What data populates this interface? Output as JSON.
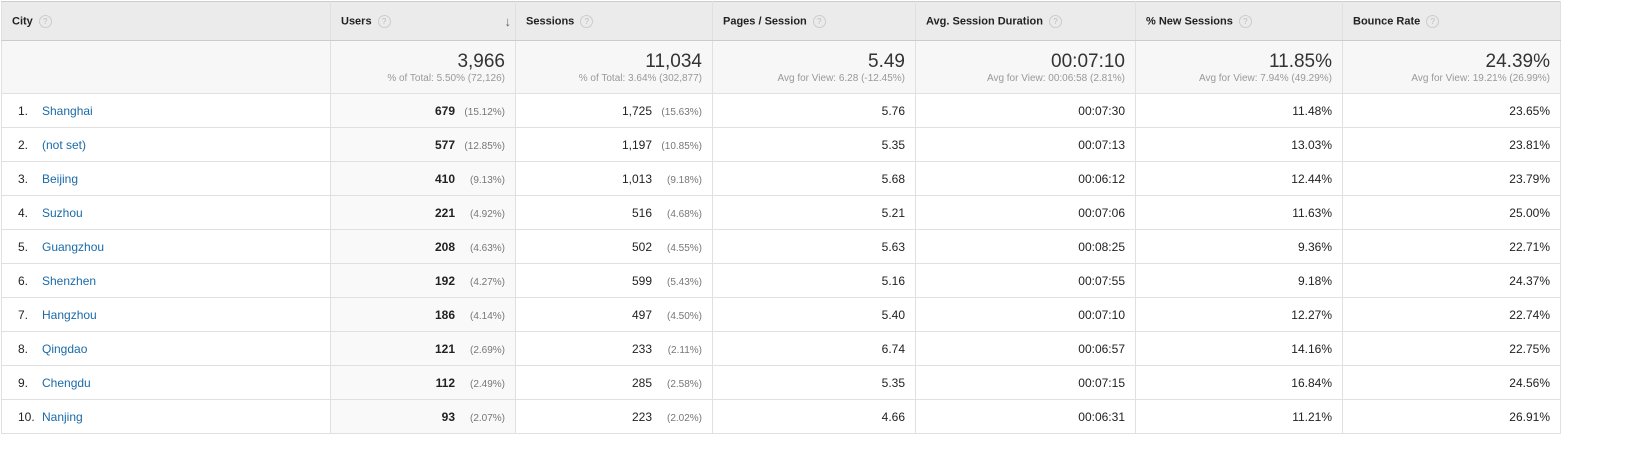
{
  "headers": [
    "City",
    "Users",
    "Sessions",
    "Pages / Session",
    "Avg. Session Duration",
    "% New Sessions",
    "Bounce Rate"
  ],
  "help_glyph": "?",
  "sort_arrow": "↓",
  "totals": [
    {
      "value": "3,966",
      "sub": "% of Total: 5.50% (72,126)"
    },
    {
      "value": "11,034",
      "sub": "% of Total: 3.64% (302,877)"
    },
    {
      "value": "5.49",
      "sub": "Avg for View: 6.28 (-12.45%)"
    },
    {
      "value": "00:07:10",
      "sub": "Avg for View: 00:06:58 (2.81%)"
    },
    {
      "value": "11.85%",
      "sub": "Avg for View: 7.94% (49.29%)"
    },
    {
      "value": "24.39%",
      "sub": "Avg for View: 19.21% (26.99%)"
    }
  ],
  "rows": [
    {
      "idx": "1.",
      "city": "Shanghai",
      "users": "679",
      "users_pct": "(15.12%)",
      "sessions": "1,725",
      "sessions_pct": "(15.63%)",
      "pages": "5.76",
      "duration": "00:07:30",
      "new": "11.48%",
      "bounce": "23.65%"
    },
    {
      "idx": "2.",
      "city": "(not set)",
      "users": "577",
      "users_pct": "(12.85%)",
      "sessions": "1,197",
      "sessions_pct": "(10.85%)",
      "pages": "5.35",
      "duration": "00:07:13",
      "new": "13.03%",
      "bounce": "23.81%"
    },
    {
      "idx": "3.",
      "city": "Beijing",
      "users": "410",
      "users_pct": "(9.13%)",
      "sessions": "1,013",
      "sessions_pct": "(9.18%)",
      "pages": "5.68",
      "duration": "00:06:12",
      "new": "12.44%",
      "bounce": "23.79%"
    },
    {
      "idx": "4.",
      "city": "Suzhou",
      "users": "221",
      "users_pct": "(4.92%)",
      "sessions": "516",
      "sessions_pct": "(4.68%)",
      "pages": "5.21",
      "duration": "00:07:06",
      "new": "11.63%",
      "bounce": "25.00%"
    },
    {
      "idx": "5.",
      "city": "Guangzhou",
      "users": "208",
      "users_pct": "(4.63%)",
      "sessions": "502",
      "sessions_pct": "(4.55%)",
      "pages": "5.63",
      "duration": "00:08:25",
      "new": "9.36%",
      "bounce": "22.71%"
    },
    {
      "idx": "6.",
      "city": "Shenzhen",
      "users": "192",
      "users_pct": "(4.27%)",
      "sessions": "599",
      "sessions_pct": "(5.43%)",
      "pages": "5.16",
      "duration": "00:07:55",
      "new": "9.18%",
      "bounce": "24.37%"
    },
    {
      "idx": "7.",
      "city": "Hangzhou",
      "users": "186",
      "users_pct": "(4.14%)",
      "sessions": "497",
      "sessions_pct": "(4.50%)",
      "pages": "5.40",
      "duration": "00:07:10",
      "new": "12.27%",
      "bounce": "22.74%"
    },
    {
      "idx": "8.",
      "city": "Qingdao",
      "users": "121",
      "users_pct": "(2.69%)",
      "sessions": "233",
      "sessions_pct": "(2.11%)",
      "pages": "6.74",
      "duration": "00:06:57",
      "new": "14.16%",
      "bounce": "22.75%"
    },
    {
      "idx": "9.",
      "city": "Chengdu",
      "users": "112",
      "users_pct": "(2.49%)",
      "sessions": "285",
      "sessions_pct": "(2.58%)",
      "pages": "5.35",
      "duration": "00:07:15",
      "new": "16.84%",
      "bounce": "24.56%"
    },
    {
      "idx": "10.",
      "city": "Nanjing",
      "users": "93",
      "users_pct": "(2.07%)",
      "sessions": "223",
      "sessions_pct": "(2.02%)",
      "pages": "4.66",
      "duration": "00:06:31",
      "new": "11.21%",
      "bounce": "26.91%"
    }
  ]
}
